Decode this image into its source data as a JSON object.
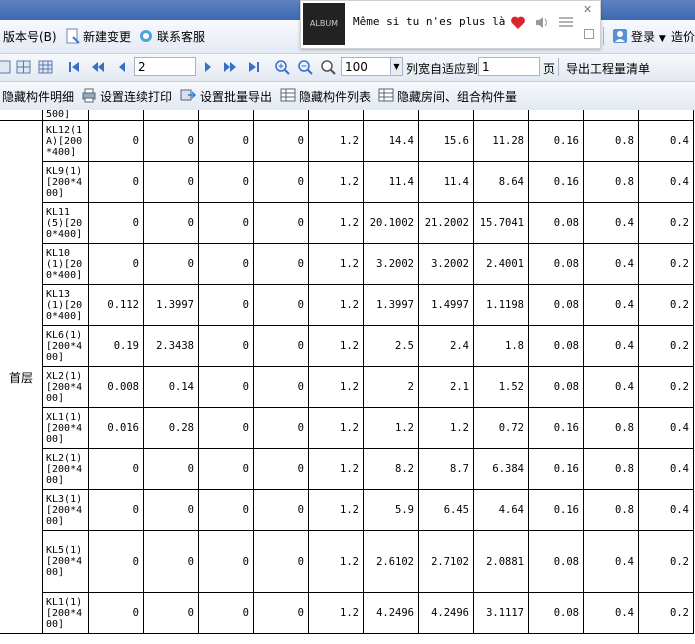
{
  "menu": {
    "version": "版本号(B)",
    "new_change": "新建变更",
    "support": "联系客服",
    "login": "登录",
    "cost": "造价"
  },
  "music": {
    "song": "Même si tu n'es plus là",
    "album_text": "ALBUM"
  },
  "toolbar1": {
    "page_value": "2",
    "zoom_value": "100",
    "fit_columns_label": "列宽自适应到",
    "fit_value": "1",
    "page_unit": "页",
    "export_list": "导出工程量清单"
  },
  "toolbar2": {
    "hide_detail": "隐藏构件明细",
    "continuous_print": "设置连续打印",
    "batch_export": "设置批量导出",
    "hide_list": "隐藏构件列表",
    "hide_rooms": "隐藏房间、组合构件量"
  },
  "table": {
    "floor": "首层",
    "partial_top": "500]",
    "rows": [
      {
        "name": "KL12(1A)[200*400]",
        "v": [
          "0",
          "0",
          "0",
          "0",
          "1.2",
          "14.4",
          "15.6",
          "11.28",
          "0.16",
          "0.8",
          "0.4"
        ]
      },
      {
        "name": "KL9(1)[200*400]",
        "v": [
          "0",
          "0",
          "0",
          "0",
          "1.2",
          "11.4",
          "11.4",
          "8.64",
          "0.16",
          "0.8",
          "0.4"
        ]
      },
      {
        "name": "KL11(5)[200*400]",
        "v": [
          "0",
          "0",
          "0",
          "0",
          "1.2",
          "20.1002",
          "21.2002",
          "15.7041",
          "0.08",
          "0.4",
          "0.2"
        ]
      },
      {
        "name": "KL10(1)[200*400]",
        "v": [
          "0",
          "0",
          "0",
          "0",
          "1.2",
          "3.2002",
          "3.2002",
          "2.4001",
          "0.08",
          "0.4",
          "0.2"
        ]
      },
      {
        "name": "KL13(1)[200*400]",
        "v": [
          "0.112",
          "1.3997",
          "0",
          "0",
          "1.2",
          "1.3997",
          "1.4997",
          "1.1198",
          "0.08",
          "0.4",
          "0.2"
        ]
      },
      {
        "name": "KL6(1)[200*400]",
        "v": [
          "0.19",
          "2.3438",
          "0",
          "0",
          "1.2",
          "2.5",
          "2.4",
          "1.8",
          "0.08",
          "0.4",
          "0.2"
        ]
      },
      {
        "name": "XL2(1)[200*400]",
        "v": [
          "0.008",
          "0.14",
          "0",
          "0",
          "1.2",
          "2",
          "2.1",
          "1.52",
          "0.08",
          "0.4",
          "0.2"
        ]
      },
      {
        "name": "XL1(1)[200*400]",
        "v": [
          "0.016",
          "0.28",
          "0",
          "0",
          "1.2",
          "1.2",
          "1.2",
          "0.72",
          "0.16",
          "0.8",
          "0.4"
        ]
      },
      {
        "name": "KL2(1)[200*400]",
        "v": [
          "0",
          "0",
          "0",
          "0",
          "1.2",
          "8.2",
          "8.7",
          "6.384",
          "0.16",
          "0.8",
          "0.4"
        ]
      },
      {
        "name": "KL3(1)[200*400]",
        "v": [
          "0",
          "0",
          "0",
          "0",
          "1.2",
          "5.9",
          "6.45",
          "4.64",
          "0.16",
          "0.8",
          "0.4"
        ]
      },
      {
        "name": "KL5(1)[200*400]",
        "v": [
          "0",
          "0",
          "0",
          "0",
          "1.2",
          "2.6102",
          "2.7102",
          "2.0881",
          "0.08",
          "0.4",
          "0.2"
        ]
      },
      {
        "name": "KL1(1)[200*400]",
        "v": [
          "0",
          "0",
          "0",
          "0",
          "1.2",
          "4.2496",
          "4.2496",
          "3.1117",
          "0.08",
          "0.4",
          "0.2"
        ]
      }
    ]
  }
}
